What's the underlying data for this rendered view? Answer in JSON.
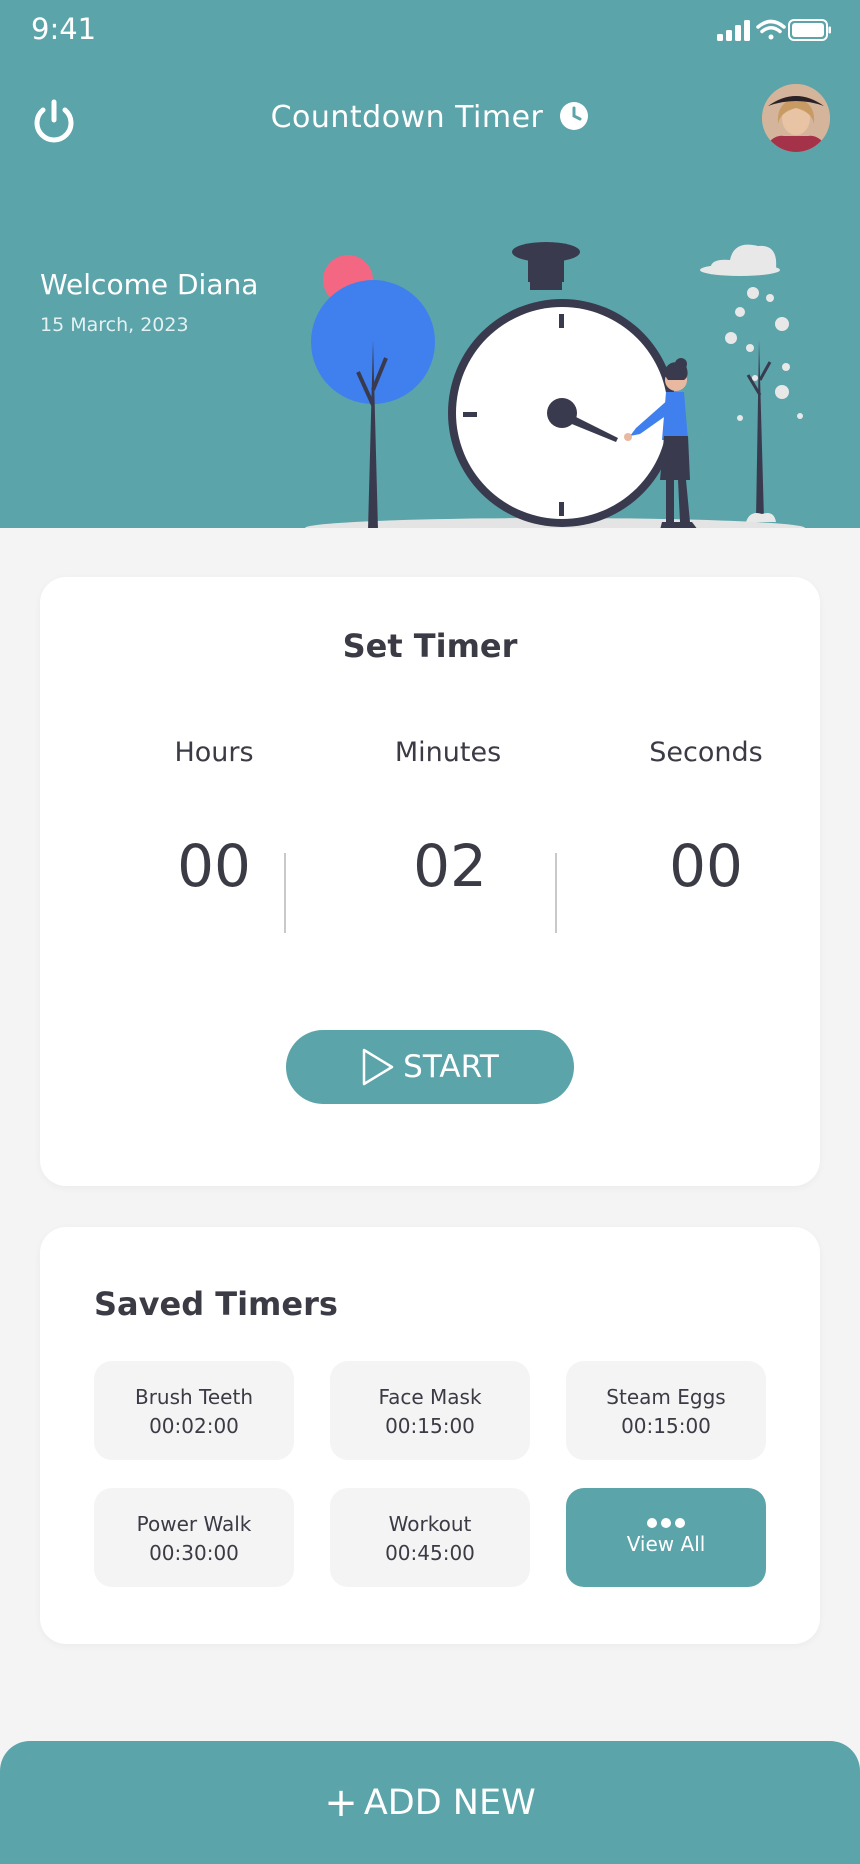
{
  "status_bar": {
    "time": "9:41"
  },
  "header": {
    "title": "Countdown Timer",
    "welcome": "Welcome Diana",
    "date": "15 March, 2023",
    "icons": {
      "power": "power-icon",
      "title": "clock-icon",
      "avatar": "user-avatar"
    }
  },
  "set_timer": {
    "title": "Set Timer",
    "units": [
      {
        "label": "Hours",
        "value": "00"
      },
      {
        "label": "Minutes",
        "value": "02"
      },
      {
        "label": "Seconds",
        "value": "00"
      }
    ],
    "start_label": "START"
  },
  "saved_timers": {
    "title": "Saved Timers",
    "items": [
      {
        "name": "Brush Teeth",
        "time": "00:02:00"
      },
      {
        "name": "Face Mask",
        "time": "00:15:00"
      },
      {
        "name": "Steam Eggs",
        "time": "00:15:00"
      },
      {
        "name": "Power Walk",
        "time": "00:30:00"
      },
      {
        "name": "Workout",
        "time": "00:45:00"
      }
    ],
    "view_all_label": "View All"
  },
  "add_new_label": "ADD NEW",
  "colors": {
    "primary": "#5ba4aa",
    "background": "#f4f4f4",
    "text": "#3b3b45",
    "tree": "#3f80ee",
    "accent": "#f46782"
  }
}
